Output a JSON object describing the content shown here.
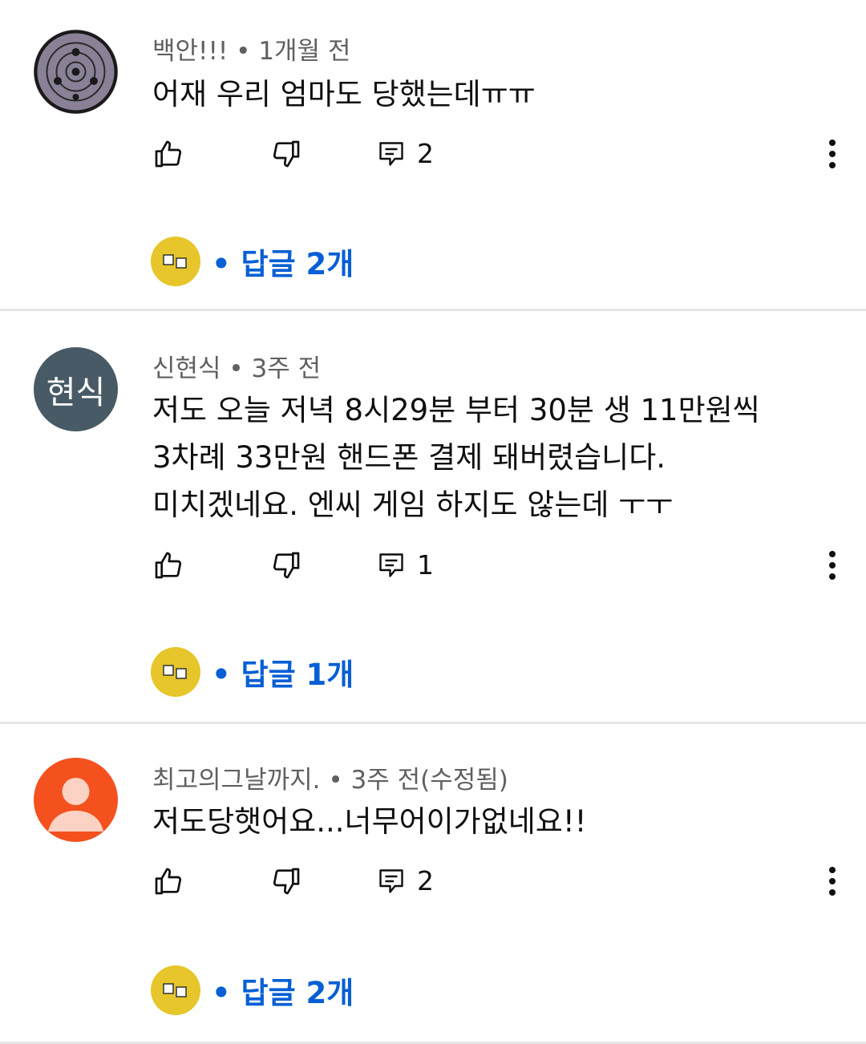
{
  "comments": [
    {
      "author": "백안!!!",
      "time": "1개월 전",
      "meta": "백안!!! • 1개월 전",
      "lines": [
        "어재 우리 엄마도 당했는데ㅠㅠ"
      ],
      "reply_count": "2",
      "replies_label": "• 답글 2개",
      "avatar": {
        "type": "image",
        "icon": "sharingan-icon"
      }
    },
    {
      "author": "신현식",
      "time": "3주 전",
      "meta": "신현식 • 3주 전",
      "lines": [
        "저도 오늘 저녁 8시29분 부터 30분 생 11만원씩",
        "3차례 33만원 핸드폰 결제 돼버렸습니다.",
        "미치겠네요. 엔씨 게임 하지도 않는데 ㅜㅜ"
      ],
      "reply_count": "1",
      "replies_label": "• 답글 1개",
      "avatar": {
        "type": "text",
        "text": "현식",
        "color": "#475a66"
      }
    },
    {
      "author": "최고의그날까지.",
      "time": "3주 전(수정됨)",
      "meta": "최고의그날까지. • 3주 전(수정됨)",
      "lines": [
        "저도당햇어요...너무어이가없네요!!"
      ],
      "reply_count": "2",
      "replies_label": "• 답글 2개",
      "avatar": {
        "type": "default",
        "color": "#f4511e"
      }
    }
  ],
  "colors": {
    "link": "#065fd4",
    "meta": "#606060",
    "creator_avatar": "#e6c62a"
  },
  "icons": [
    "thumb-up-icon",
    "thumb-down-icon",
    "reply-icon",
    "more-vert-icon",
    "creator-avatar-icon"
  ]
}
